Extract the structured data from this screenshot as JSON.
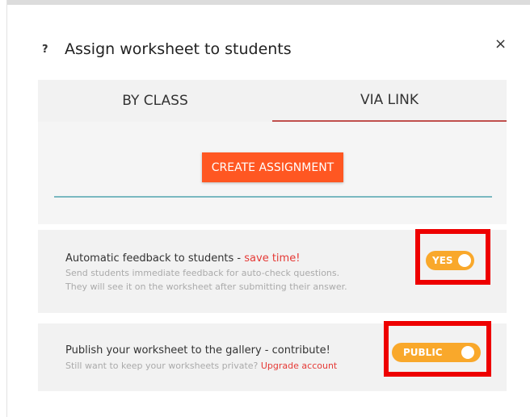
{
  "dialog": {
    "help_icon": "?",
    "title": "Assign worksheet to students",
    "close_icon": "×"
  },
  "tabs": [
    {
      "label": "BY CLASS",
      "active": false
    },
    {
      "label": "VIA LINK",
      "active": true
    }
  ],
  "content": {
    "create_button": "CREATE ASSIGNMENT"
  },
  "feedback": {
    "title": "Automatic feedback to students - ",
    "title_accent": "save time!",
    "sub1": "Send students immediate feedback for auto-check questions.",
    "sub2": "They will see it on the worksheet after submitting their answer.",
    "toggle_label": "YES",
    "toggle_on": true
  },
  "publish": {
    "title": "Publish your worksheet to the gallery - contribute!",
    "sub": "Still want to keep your worksheets private? ",
    "upgrade_link": "Upgrade account",
    "toggle_label": "PUBLIC",
    "toggle_on": true
  },
  "colors": {
    "accent_orange": "#ff5722",
    "toggle_orange": "#f9a82b",
    "highlight_red": "#ee0000",
    "teal": "#7ab8c0",
    "tab_underline": "#c0504d"
  }
}
